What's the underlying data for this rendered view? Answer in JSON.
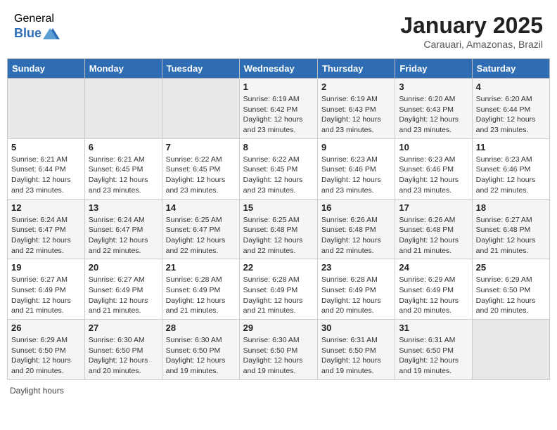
{
  "header": {
    "logo_general": "General",
    "logo_blue": "Blue",
    "month_title": "January 2025",
    "location": "Carauari, Amazonas, Brazil"
  },
  "footer": {
    "daylight_label": "Daylight hours"
  },
  "days_of_week": [
    "Sunday",
    "Monday",
    "Tuesday",
    "Wednesday",
    "Thursday",
    "Friday",
    "Saturday"
  ],
  "weeks": [
    [
      {
        "day": "",
        "info": ""
      },
      {
        "day": "",
        "info": ""
      },
      {
        "day": "",
        "info": ""
      },
      {
        "day": "1",
        "info": "Sunrise: 6:19 AM\nSunset: 6:42 PM\nDaylight: 12 hours\nand 23 minutes."
      },
      {
        "day": "2",
        "info": "Sunrise: 6:19 AM\nSunset: 6:43 PM\nDaylight: 12 hours\nand 23 minutes."
      },
      {
        "day": "3",
        "info": "Sunrise: 6:20 AM\nSunset: 6:43 PM\nDaylight: 12 hours\nand 23 minutes."
      },
      {
        "day": "4",
        "info": "Sunrise: 6:20 AM\nSunset: 6:44 PM\nDaylight: 12 hours\nand 23 minutes."
      }
    ],
    [
      {
        "day": "5",
        "info": "Sunrise: 6:21 AM\nSunset: 6:44 PM\nDaylight: 12 hours\nand 23 minutes."
      },
      {
        "day": "6",
        "info": "Sunrise: 6:21 AM\nSunset: 6:45 PM\nDaylight: 12 hours\nand 23 minutes."
      },
      {
        "day": "7",
        "info": "Sunrise: 6:22 AM\nSunset: 6:45 PM\nDaylight: 12 hours\nand 23 minutes."
      },
      {
        "day": "8",
        "info": "Sunrise: 6:22 AM\nSunset: 6:45 PM\nDaylight: 12 hours\nand 23 minutes."
      },
      {
        "day": "9",
        "info": "Sunrise: 6:23 AM\nSunset: 6:46 PM\nDaylight: 12 hours\nand 23 minutes."
      },
      {
        "day": "10",
        "info": "Sunrise: 6:23 AM\nSunset: 6:46 PM\nDaylight: 12 hours\nand 23 minutes."
      },
      {
        "day": "11",
        "info": "Sunrise: 6:23 AM\nSunset: 6:46 PM\nDaylight: 12 hours\nand 22 minutes."
      }
    ],
    [
      {
        "day": "12",
        "info": "Sunrise: 6:24 AM\nSunset: 6:47 PM\nDaylight: 12 hours\nand 22 minutes."
      },
      {
        "day": "13",
        "info": "Sunrise: 6:24 AM\nSunset: 6:47 PM\nDaylight: 12 hours\nand 22 minutes."
      },
      {
        "day": "14",
        "info": "Sunrise: 6:25 AM\nSunset: 6:47 PM\nDaylight: 12 hours\nand 22 minutes."
      },
      {
        "day": "15",
        "info": "Sunrise: 6:25 AM\nSunset: 6:48 PM\nDaylight: 12 hours\nand 22 minutes."
      },
      {
        "day": "16",
        "info": "Sunrise: 6:26 AM\nSunset: 6:48 PM\nDaylight: 12 hours\nand 22 minutes."
      },
      {
        "day": "17",
        "info": "Sunrise: 6:26 AM\nSunset: 6:48 PM\nDaylight: 12 hours\nand 21 minutes."
      },
      {
        "day": "18",
        "info": "Sunrise: 6:27 AM\nSunset: 6:48 PM\nDaylight: 12 hours\nand 21 minutes."
      }
    ],
    [
      {
        "day": "19",
        "info": "Sunrise: 6:27 AM\nSunset: 6:49 PM\nDaylight: 12 hours\nand 21 minutes."
      },
      {
        "day": "20",
        "info": "Sunrise: 6:27 AM\nSunset: 6:49 PM\nDaylight: 12 hours\nand 21 minutes."
      },
      {
        "day": "21",
        "info": "Sunrise: 6:28 AM\nSunset: 6:49 PM\nDaylight: 12 hours\nand 21 minutes."
      },
      {
        "day": "22",
        "info": "Sunrise: 6:28 AM\nSunset: 6:49 PM\nDaylight: 12 hours\nand 21 minutes."
      },
      {
        "day": "23",
        "info": "Sunrise: 6:28 AM\nSunset: 6:49 PM\nDaylight: 12 hours\nand 20 minutes."
      },
      {
        "day": "24",
        "info": "Sunrise: 6:29 AM\nSunset: 6:49 PM\nDaylight: 12 hours\nand 20 minutes."
      },
      {
        "day": "25",
        "info": "Sunrise: 6:29 AM\nSunset: 6:50 PM\nDaylight: 12 hours\nand 20 minutes."
      }
    ],
    [
      {
        "day": "26",
        "info": "Sunrise: 6:29 AM\nSunset: 6:50 PM\nDaylight: 12 hours\nand 20 minutes."
      },
      {
        "day": "27",
        "info": "Sunrise: 6:30 AM\nSunset: 6:50 PM\nDaylight: 12 hours\nand 20 minutes."
      },
      {
        "day": "28",
        "info": "Sunrise: 6:30 AM\nSunset: 6:50 PM\nDaylight: 12 hours\nand 19 minutes."
      },
      {
        "day": "29",
        "info": "Sunrise: 6:30 AM\nSunset: 6:50 PM\nDaylight: 12 hours\nand 19 minutes."
      },
      {
        "day": "30",
        "info": "Sunrise: 6:31 AM\nSunset: 6:50 PM\nDaylight: 12 hours\nand 19 minutes."
      },
      {
        "day": "31",
        "info": "Sunrise: 6:31 AM\nSunset: 6:50 PM\nDaylight: 12 hours\nand 19 minutes."
      },
      {
        "day": "",
        "info": ""
      }
    ]
  ]
}
